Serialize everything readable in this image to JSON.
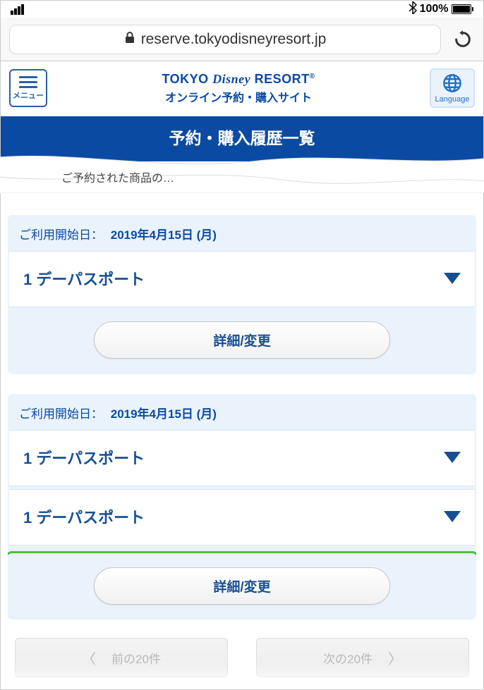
{
  "status": {
    "battery_pct": "100%"
  },
  "safari": {
    "url": "reserve.tokyodisneyresort.jp"
  },
  "header": {
    "menu_label": "メニュー",
    "brand_top": "TOKYO Disney RESORT",
    "brand_regmark": "®",
    "brand_sub": "オンライン予約・購入サイト",
    "language_label": "Language"
  },
  "section": {
    "title": "予約・購入履歴一覧",
    "peek_text": "ご予約された商品の…"
  },
  "orders": [
    {
      "date_label": "ご利用開始日：",
      "date_value": "2019年4月15日 (月)",
      "products": [
        "1 デーパスポート"
      ],
      "action_label": "詳細/変更",
      "highlighted": false
    },
    {
      "date_label": "ご利用開始日：",
      "date_value": "2019年4月15日 (月)",
      "products": [
        "1 デーパスポート",
        "1 デーパスポート"
      ],
      "action_label": "詳細/変更",
      "highlighted": true
    }
  ],
  "pagination": {
    "prev_label": "前の20件",
    "next_label": "次の20件"
  }
}
